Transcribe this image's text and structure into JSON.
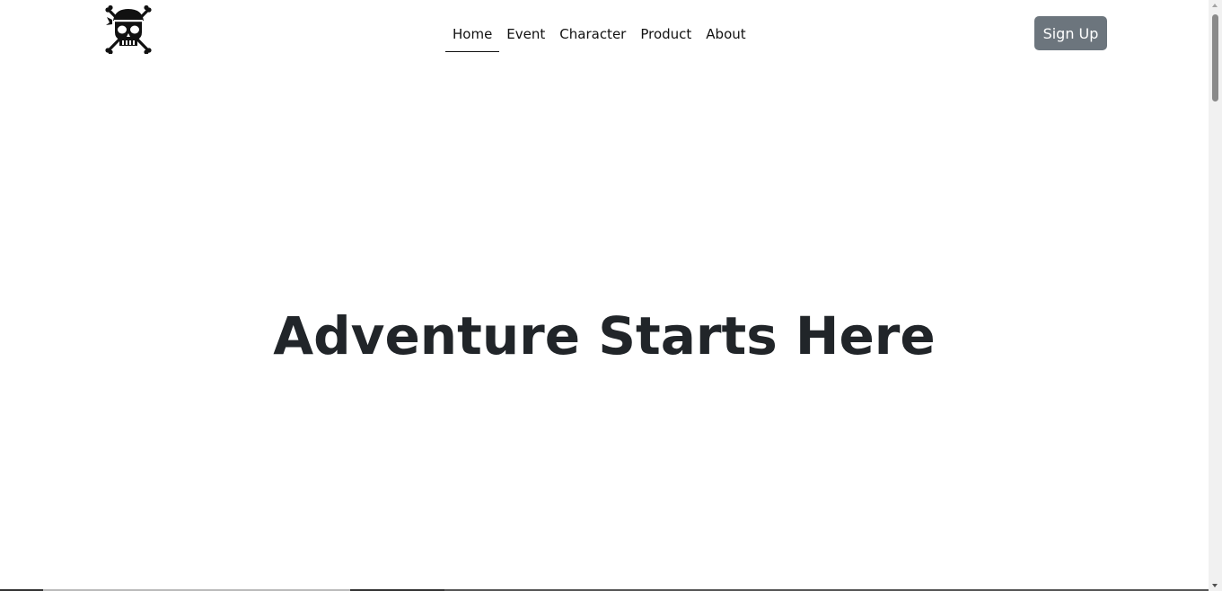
{
  "navbar": {
    "logo_icon": "pirate-skull-crossbones-icon",
    "links": [
      {
        "label": "Home",
        "active": true
      },
      {
        "label": "Event",
        "active": false
      },
      {
        "label": "Character",
        "active": false
      },
      {
        "label": "Product",
        "active": false
      },
      {
        "label": "About",
        "active": false
      }
    ],
    "signup_label": "Sign Up"
  },
  "hero": {
    "title": "Adventure Starts Here"
  },
  "colors": {
    "button_bg": "#6c757d",
    "text": "#212529"
  }
}
